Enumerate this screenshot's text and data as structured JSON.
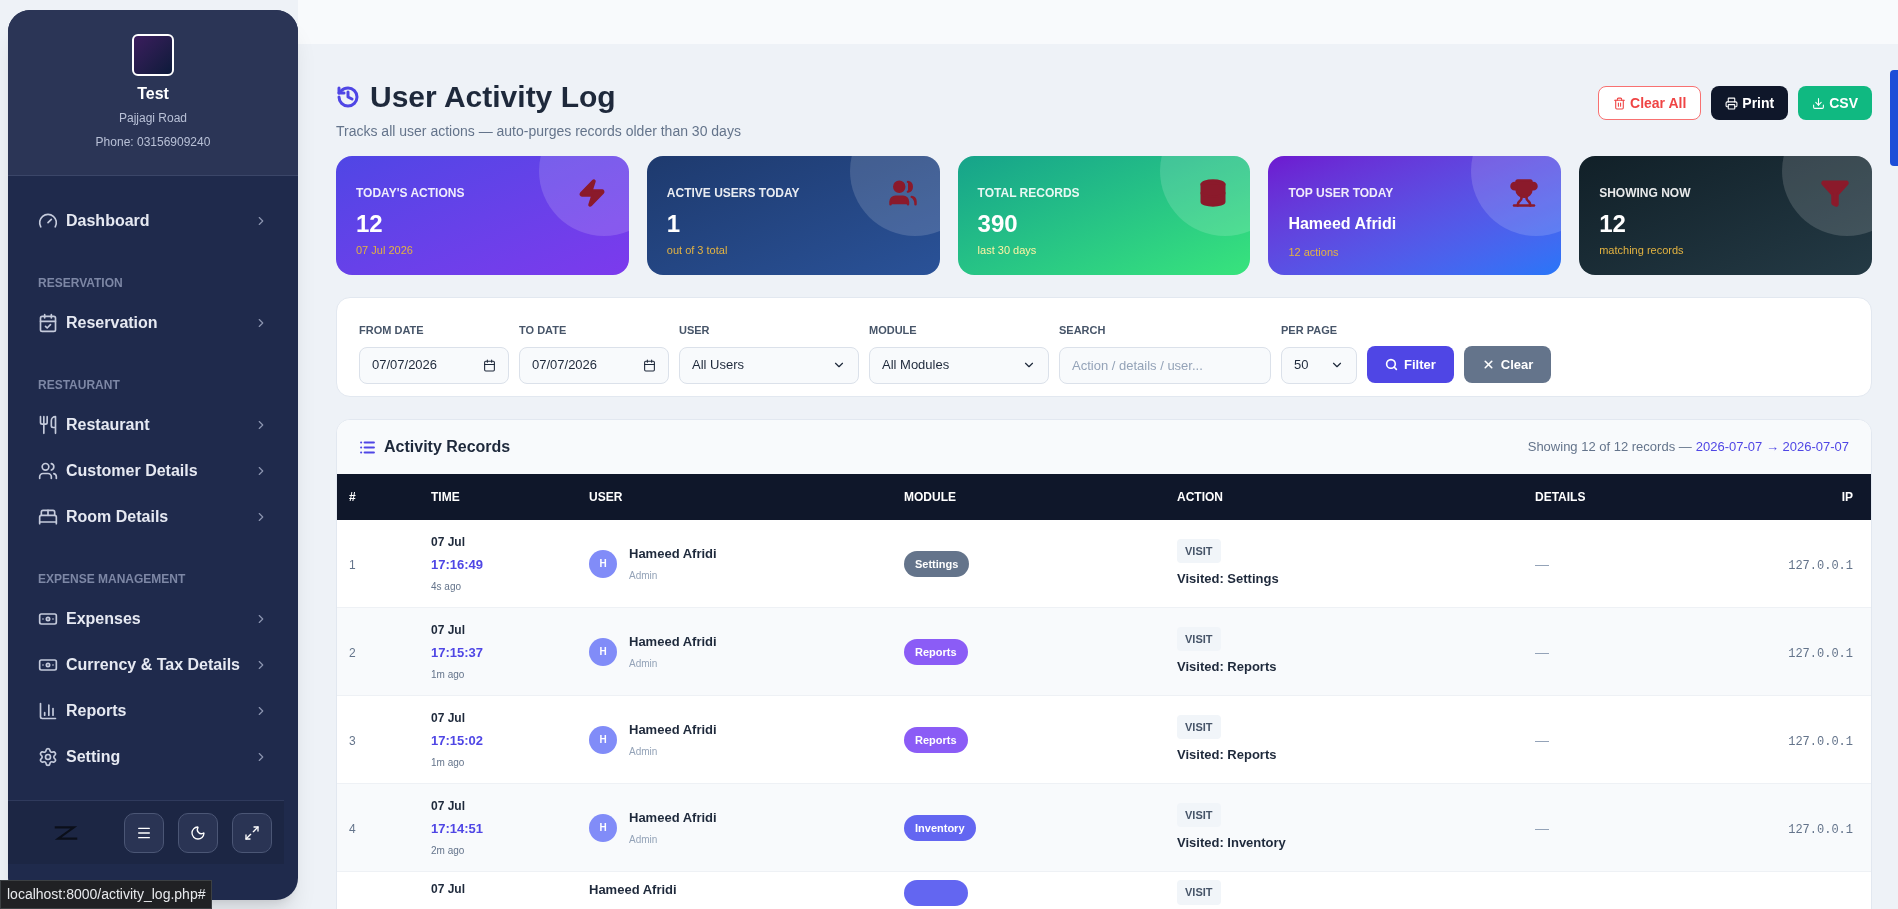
{
  "sidebar": {
    "profile": {
      "name": "Test",
      "address": "Pajjagi Road",
      "phone": "Phone: 03156909240"
    },
    "sections": [
      {
        "items": [
          {
            "label": "Dashboard"
          }
        ]
      },
      {
        "heading": "RESERVATION",
        "items": [
          {
            "label": "Reservation"
          }
        ]
      },
      {
        "heading": "RESTAURANT",
        "items": [
          {
            "label": "Restaurant"
          },
          {
            "label": "Customer Details"
          },
          {
            "label": "Room Details"
          }
        ]
      },
      {
        "heading": "EXPENSE MANAGEMENT",
        "items": [
          {
            "label": "Expenses"
          },
          {
            "label": "Currency & Tax Details"
          },
          {
            "label": "Reports"
          },
          {
            "label": "Setting"
          }
        ]
      }
    ]
  },
  "status_url": "localhost:8000/activity_log.php#",
  "header": {
    "title": "User Activity Log",
    "subtitle": "Tracks all user actions — auto-purges records older than 30 days",
    "buttons": [
      {
        "label": "Clear All",
        "kind": "danger"
      },
      {
        "label": "Print",
        "kind": "dark"
      },
      {
        "label": "CSV",
        "kind": "success"
      }
    ]
  },
  "cards": [
    {
      "title": "TODAY'S ACTIONS",
      "value": "12",
      "sub": "07 Jul 2026",
      "kind": "count"
    },
    {
      "title": "ACTIVE USERS TODAY",
      "value": "1",
      "sub": "out of 3 total",
      "kind": "count"
    },
    {
      "title": "TOTAL RECORDS",
      "value": "390",
      "sub": "last 30 days",
      "kind": "count"
    },
    {
      "title": "TOP USER TODAY",
      "value": "Hameed Afridi",
      "sub": "12 actions",
      "kind": "name"
    },
    {
      "title": "SHOWING NOW",
      "value": "12",
      "sub": "matching records",
      "kind": "count"
    }
  ],
  "filters": [
    {
      "label": "FROM DATE",
      "kind": "date",
      "value": "07/07/2026"
    },
    {
      "label": "TO DATE",
      "kind": "date",
      "value": "07/07/2026"
    },
    {
      "label": "USER",
      "kind": "select",
      "value": "All Users"
    },
    {
      "label": "MODULE",
      "kind": "select",
      "value": "All Modules"
    },
    {
      "label": "SEARCH",
      "kind": "text",
      "placeholder": "Action / details / user..."
    },
    {
      "label": "PER PAGE",
      "kind": "select",
      "value": "50"
    }
  ],
  "filter_buttons": [
    {
      "label": "Filter",
      "kind": "primary"
    },
    {
      "label": "Clear",
      "kind": "secondary"
    }
  ],
  "table": {
    "title": "Activity Records",
    "summary": "Showing 12 of 12 records —",
    "range": "2026-07-07 → 2026-07-07",
    "columns": [
      "#",
      "TIME",
      "USER",
      "MODULE",
      "ACTION",
      "DETAILS",
      "IP"
    ],
    "rows": [
      {
        "index": "1",
        "date": "07 Jul",
        "time": "17:16:49",
        "ago": "4s ago",
        "avatar": "H",
        "user": "Hameed Afridi",
        "role": "Admin",
        "module": {
          "label": "Settings",
          "color": "#64748b"
        },
        "action_tag": "VISIT",
        "action": "Visited: Settings",
        "details": "—",
        "ip": "127.0.0.1"
      },
      {
        "index": "2",
        "date": "07 Jul",
        "time": "17:15:37",
        "ago": "1m ago",
        "avatar": "H",
        "user": "Hameed Afridi",
        "role": "Admin",
        "module": {
          "label": "Reports",
          "color": "#8b5cf6"
        },
        "action_tag": "VISIT",
        "action": "Visited: Reports",
        "details": "—",
        "ip": "127.0.0.1"
      },
      {
        "index": "3",
        "date": "07 Jul",
        "time": "17:15:02",
        "ago": "1m ago",
        "avatar": "H",
        "user": "Hameed Afridi",
        "role": "Admin",
        "module": {
          "label": "Reports",
          "color": "#8b5cf6"
        },
        "action_tag": "VISIT",
        "action": "Visited: Reports",
        "details": "—",
        "ip": "127.0.0.1"
      },
      {
        "index": "4",
        "date": "07 Jul",
        "time": "17:14:51",
        "ago": "2m ago",
        "avatar": "H",
        "user": "Hameed Afridi",
        "role": "Admin",
        "module": {
          "label": "Inventory",
          "color": "#6366f1"
        },
        "action_tag": "VISIT",
        "action": "Visited: Inventory",
        "details": "—",
        "ip": "127.0.0.1"
      },
      {
        "date": "07 Jul",
        "user": "Hameed Afridi",
        "module": {
          "color": "#6366f1"
        },
        "action_tag": "VISIT"
      }
    ]
  }
}
